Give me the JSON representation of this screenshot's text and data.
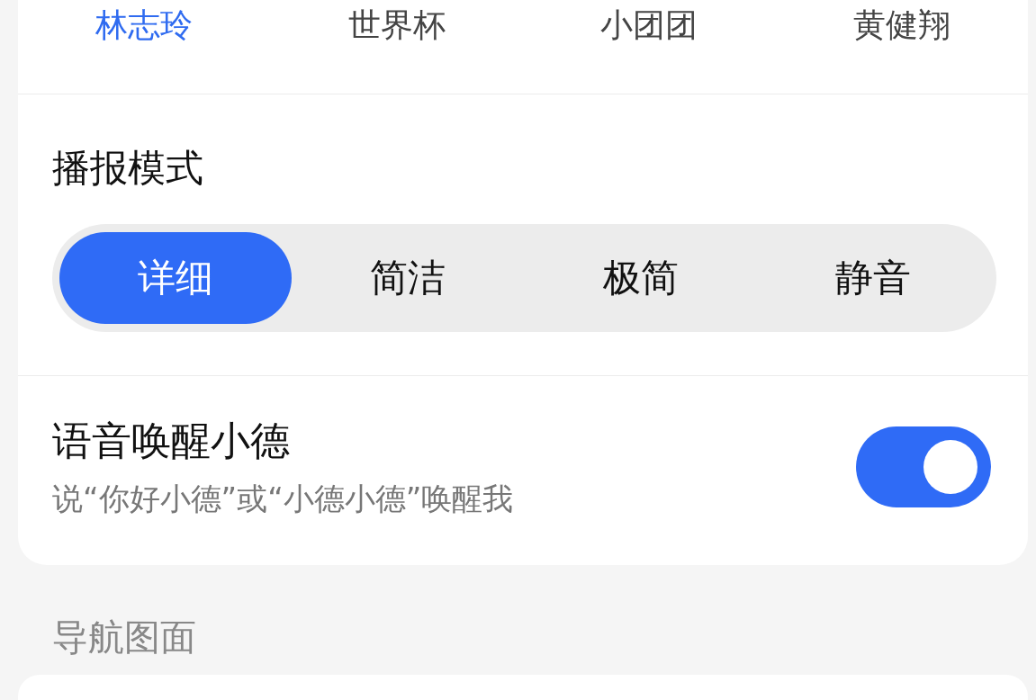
{
  "voices": [
    {
      "label": "林志玲",
      "selected": true
    },
    {
      "label": "世界杯",
      "selected": false
    },
    {
      "label": "小团团",
      "selected": false
    },
    {
      "label": "黄健翔",
      "selected": false
    }
  ],
  "broadcast_mode": {
    "title": "播报模式",
    "options": [
      {
        "label": "详细",
        "selected": true
      },
      {
        "label": "简洁",
        "selected": false
      },
      {
        "label": "极简",
        "selected": false
      },
      {
        "label": "静音",
        "selected": false
      }
    ]
  },
  "voice_wake": {
    "title": "语音唤醒小德",
    "subtitle": "说“你好小德”或“小德小德”唤醒我",
    "on": true
  },
  "next_section": {
    "title": "导航图面"
  }
}
